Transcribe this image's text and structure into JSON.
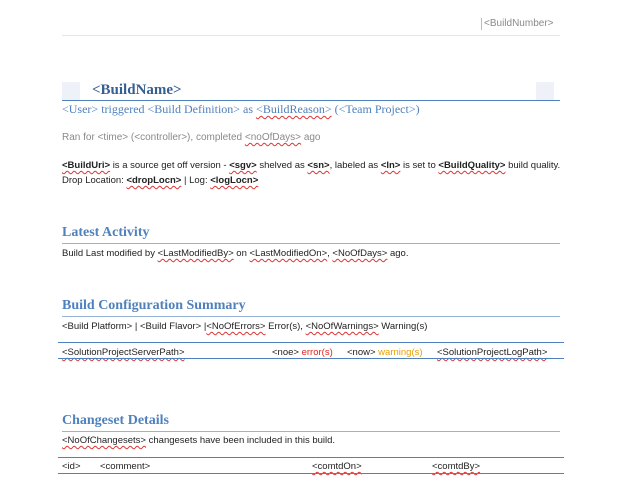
{
  "header": {
    "build_number": "<BuildNumber>"
  },
  "title_block": {
    "build_name": "<BuildName>",
    "user": "<User>",
    "triggered": "triggered",
    "build_definition": "<Build Definition>",
    "as": "as",
    "build_reason": "<BuildReason>",
    "team_project": "(<Team Project>)",
    "ran_for_prefix": "Ran for <time> (<controller>), completed ",
    "no_of_days": "<noOfDays>",
    "ago": "ago"
  },
  "source_info": {
    "build_uri": "<BuildUri>",
    "text1": "is a source get off version -",
    "sgv": "<sgv>",
    "text2": "shelved as",
    "sn": "<sn>",
    "text3": ", labeled as",
    "ln": "<ln>",
    "text4": "is set to",
    "build_quality": "<BuildQuality>",
    "text5": "build quality.",
    "drop_prefix": "Drop Location:",
    "drop_locn": "<dropLocn>",
    "log_sep": "| Log:",
    "log_locn": "<logLocn>"
  },
  "latest_activity": {
    "title": "Latest Activity",
    "prefix": "Build Last modified by ",
    "last_modified_by": "<LastModifiedBy>",
    "on": " on ",
    "last_modified_on": "<LastModifiedOn>",
    "comma": ", ",
    "no_of_days": "<NoOfDays>",
    "suffix": " ago."
  },
  "build_config": {
    "title": "Build Configuration Summary",
    "line_prefix": "<Build Platform> | <Build Flavor> |",
    "no_of_errors": "<NoOfErrors>",
    "errors_text": " Error(s), ",
    "no_of_warnings": "<NoOfWarnings>",
    "warnings_text": " Warning(s)",
    "row": {
      "server_path": "<SolutionProjectServerPath>",
      "noe": "<noe>",
      "errors_label": "error(s)",
      "now": "<now>",
      "warnings_label": "warning(s)",
      "log_path": "<SolutionProjectLogPath>"
    }
  },
  "changesets": {
    "title": "Changeset Details",
    "no_of_changesets": "<NoOfChangesets>",
    "suffix": " changesets have been included in this build.",
    "columns": {
      "id": "<id>",
      "comment": "<comment>",
      "comtd_on": "<comtdOn>",
      "comtd_by": "<comtdBy>"
    }
  },
  "colors": {
    "heading_blue": "#4f81bd",
    "rule_blue": "#95b3d7",
    "error_red": "#e0241b",
    "warning_orange": "#e8a000"
  }
}
